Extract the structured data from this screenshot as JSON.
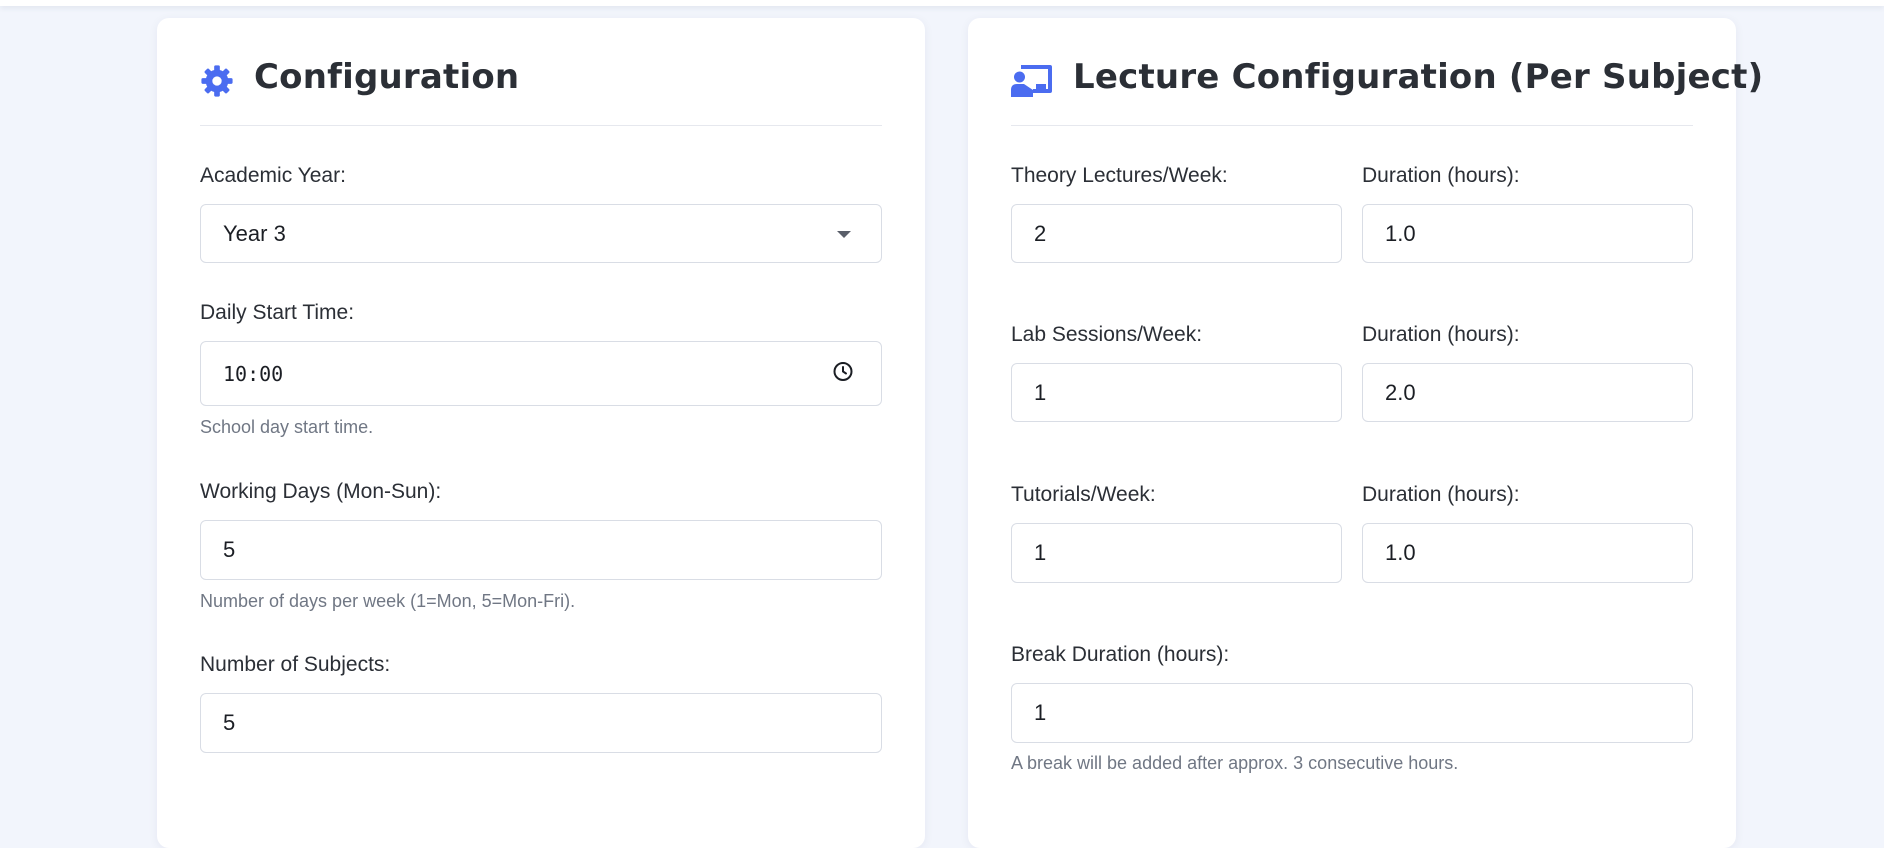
{
  "configuration": {
    "title": "Configuration",
    "icon": "gear-icon",
    "academic_year": {
      "label": "Academic Year:",
      "selected": "Year 3"
    },
    "daily_start_time": {
      "label": "Daily Start Time:",
      "value": "10:00",
      "hint": "School day start time."
    },
    "working_days": {
      "label": "Working Days (Mon-Sun):",
      "value": "5",
      "hint": "Number of days per week (1=Mon, 5=Mon-Fri)."
    },
    "number_of_subjects": {
      "label": "Number of Subjects:",
      "value": "5"
    }
  },
  "lecture_configuration": {
    "title": "Lecture Configuration (Per Subject)",
    "icon": "chalkboard-teacher-icon",
    "theory": {
      "label": "Theory Lectures/Week:",
      "value": "2",
      "duration_label": "Duration (hours):",
      "duration_value": "1.0"
    },
    "lab": {
      "label": "Lab Sessions/Week:",
      "value": "1",
      "duration_label": "Duration (hours):",
      "duration_value": "2.0"
    },
    "tutorials": {
      "label": "Tutorials/Week:",
      "value": "1",
      "duration_label": "Duration (hours):",
      "duration_value": "1.0"
    },
    "break_duration": {
      "label": "Break Duration (hours):",
      "value": "1",
      "hint": "A break will be added after approx. 3 consecutive hours."
    }
  },
  "colors": {
    "accent": "#4b6cf0",
    "background": "#f2f5fc",
    "card": "#ffffff",
    "text": "#2b2f36",
    "muted": "#707784",
    "border": "#d9dde5"
  }
}
